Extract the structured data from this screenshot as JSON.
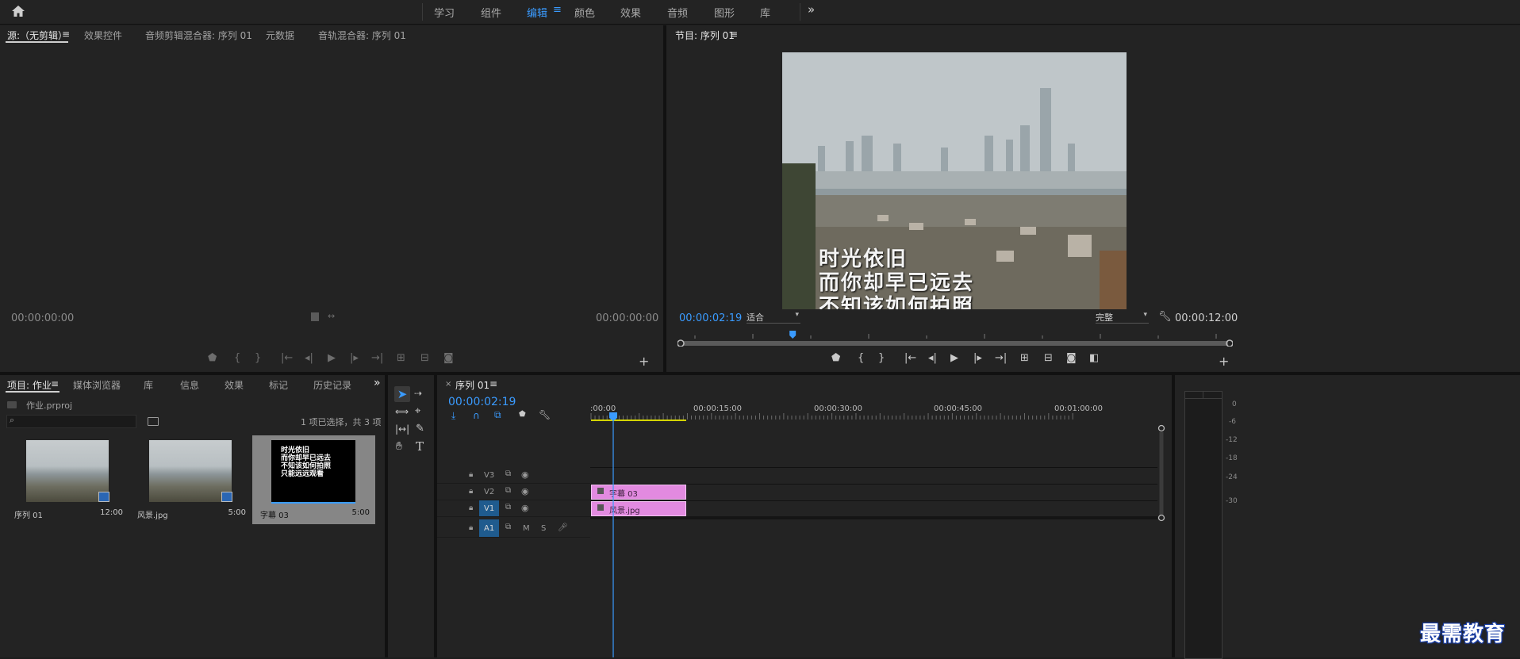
{
  "topbar": {
    "workspaces": [
      "学习",
      "组件",
      "编辑",
      "颜色",
      "效果",
      "音频",
      "图形",
      "库"
    ],
    "active": "编辑",
    "more": "»"
  },
  "source": {
    "tabs": [
      "源:（无剪辑）",
      "效果控件",
      "音频剪辑混合器: 序列 01",
      "元数据",
      "音轨混合器: 序列 01"
    ],
    "tc_left": "00:00:00:00",
    "tc_right": "00:00:00:00"
  },
  "program": {
    "title": "节目: 序列 01",
    "tc_current": "00:00:02:19",
    "fit": "适合",
    "quality": "完整",
    "tc_duration": "00:00:12:00",
    "caption_lines": [
      "时光依旧",
      "而你却早已远去",
      "不知该如何拍照"
    ],
    "playhead_fraction": 0.2
  },
  "project": {
    "tabs": [
      "项目: 作业",
      "媒体浏览器",
      "库",
      "信息",
      "效果",
      "标记",
      "历史记录"
    ],
    "file": "作业.prproj",
    "selection": "1 项已选择，共 3 项",
    "items": [
      {
        "name": "序列 01",
        "duration": "12:00"
      },
      {
        "name": "风景.jpg",
        "duration": "5:00"
      },
      {
        "name": "字幕 03",
        "duration": "5:00"
      }
    ],
    "caption_lines": [
      "时光依旧",
      "而你却早已远去",
      "不知该如何拍照",
      "只能远远观看"
    ]
  },
  "timeline": {
    "tab": "序列 01",
    "tc": "00:00:02:19",
    "ruler": [
      ":00:00",
      "00:00:15:00",
      "00:00:30:00",
      "00:00:45:00",
      "00:01:00:00"
    ],
    "tracks": [
      "V3",
      "V2",
      "V1",
      "A1"
    ],
    "mute": "M",
    "solo": "S",
    "clips": [
      {
        "name": "字幕 03",
        "track": "V2"
      },
      {
        "name": "风景.jpg",
        "track": "V1"
      }
    ]
  },
  "meter": {
    "labels": [
      "0",
      "-6",
      "-12",
      "-18",
      "-24",
      "-30"
    ]
  },
  "watermark": "最需教育",
  "colors": {
    "accent": "#3a9bff",
    "clip": "#e28ae0",
    "workarea": "#d4d400"
  }
}
